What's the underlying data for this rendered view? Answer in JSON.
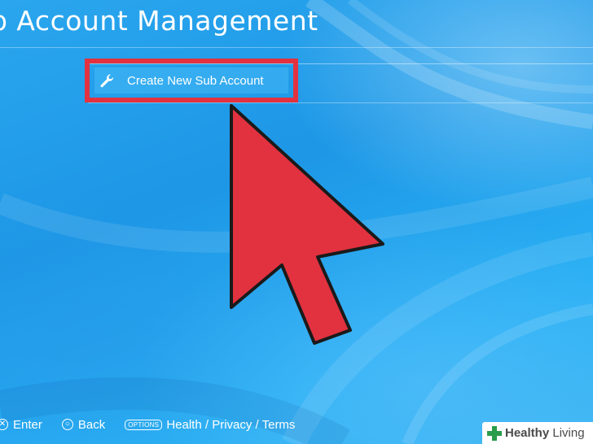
{
  "header": {
    "title": "b Account Management"
  },
  "menu": {
    "items": [
      {
        "label": "Create New Sub Account",
        "icon": "wrench-icon",
        "selected": true
      }
    ]
  },
  "annotation": {
    "highlight_color": "#e2323f",
    "arrow_color": "#e2323f"
  },
  "footer": {
    "hints": [
      {
        "icon": "cross-button-icon",
        "label": "Enter"
      },
      {
        "icon": "circle-button-icon",
        "label": "Back"
      },
      {
        "icon": "options-button-icon",
        "badge": "OPTIONS",
        "label": "Health / Privacy / Terms"
      }
    ]
  },
  "watermark": {
    "brand": "Healthy",
    "brand2": " Living",
    "icon": "medical-cross-icon",
    "color": "#2b9c4a"
  },
  "colors": {
    "background": "#1e9ae8",
    "text": "#ffffff"
  }
}
